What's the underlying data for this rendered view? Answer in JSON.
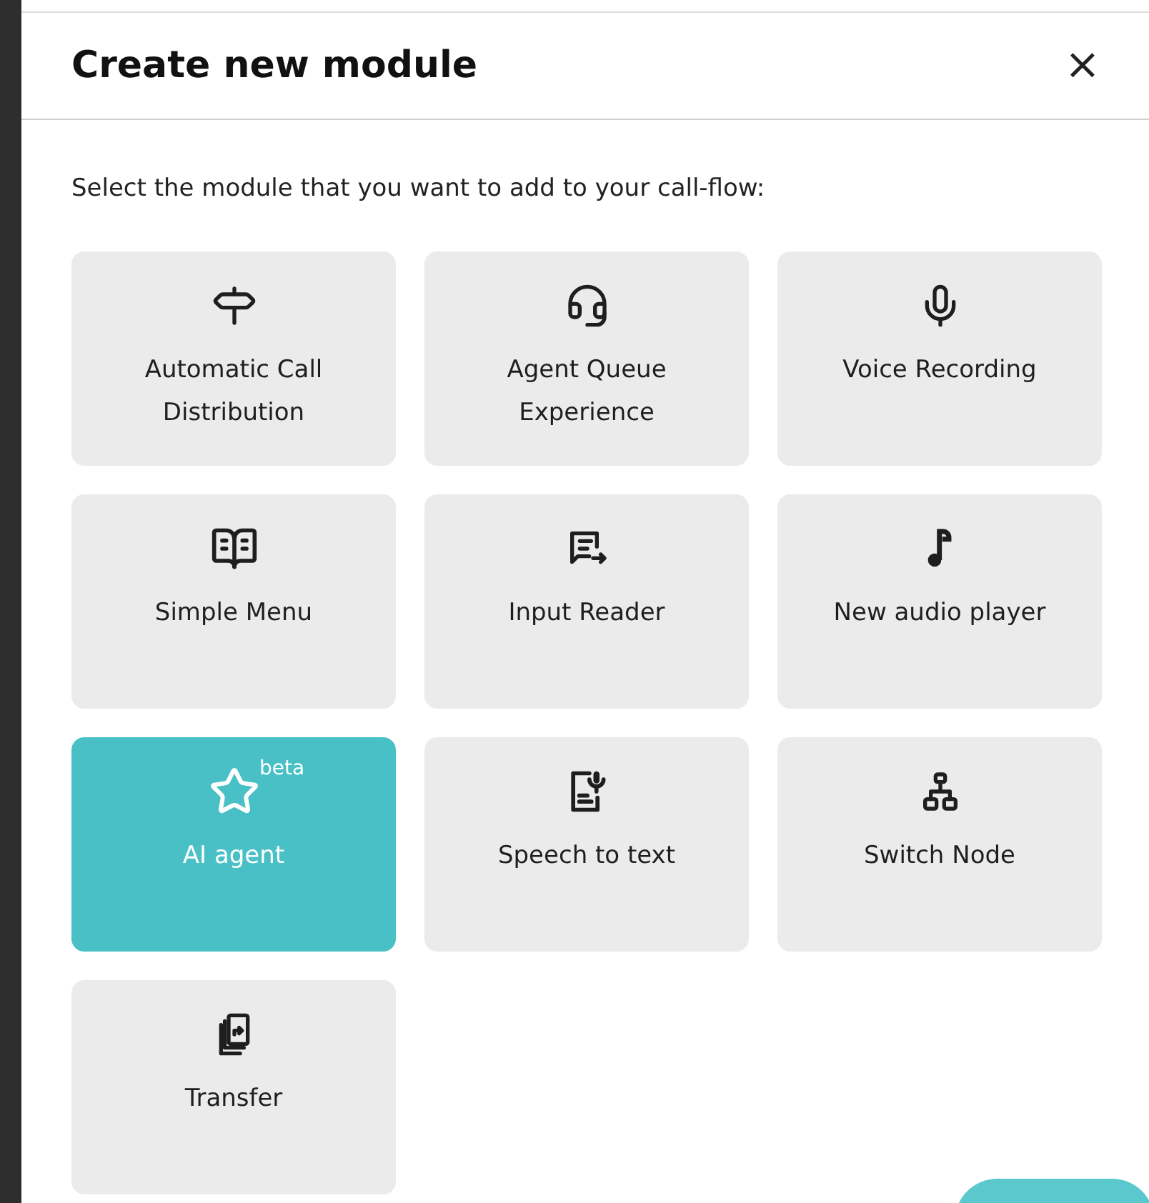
{
  "dialog": {
    "title": "Create new module",
    "close_label": "×"
  },
  "intro": "Select the module that you want to add to your call-flow:",
  "modules": [
    {
      "label": "Automatic Call Distribution",
      "selected": false
    },
    {
      "label": "Agent Queue Experience",
      "selected": false
    },
    {
      "label": "Voice Recording",
      "selected": false
    },
    {
      "label": "Simple Menu",
      "selected": false
    },
    {
      "label": "Input Reader",
      "selected": false
    },
    {
      "label": "New audio player",
      "selected": false
    },
    {
      "label": "AI agent",
      "selected": true,
      "badge": "beta"
    },
    {
      "label": "Speech to text",
      "selected": false
    },
    {
      "label": "Switch Node",
      "selected": false
    },
    {
      "label": "Transfer",
      "selected": false
    }
  ]
}
